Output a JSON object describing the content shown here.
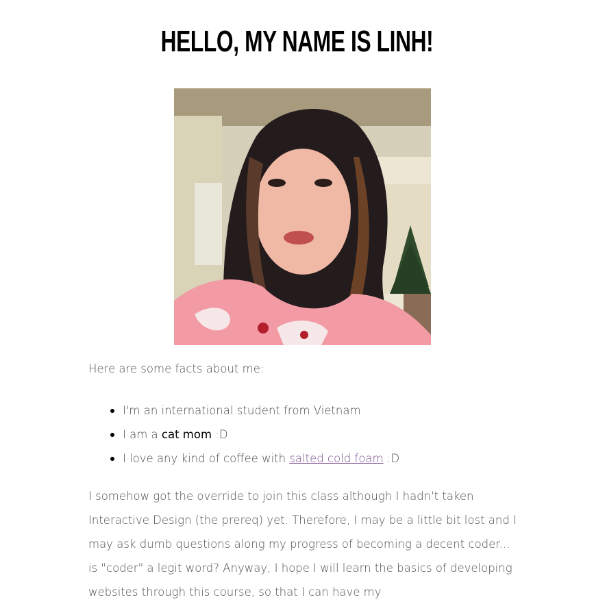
{
  "header": {
    "title": "Hello, my name is Linh!"
  },
  "photo": {
    "alt": "Portrait photo of Linh"
  },
  "intro": {
    "text": "Here are some facts about me:"
  },
  "facts": {
    "item1": {
      "text": "I'm an international student from Vietnam"
    },
    "item2": {
      "prefix": "I am a ",
      "strong": "cat mom",
      "suffix": " :D"
    },
    "item3": {
      "prefix": "I love any kind of coffee with ",
      "link": "salted cold foam",
      "suffix": " :D"
    }
  },
  "paragraph": {
    "text": "I somehow got the override to join this class although I hadn't taken Interactive Design (the prereq) yet. Therefore, I may be a little bit lost and I may ask dumb questions along my progress of becoming a decent coder... is \"coder\" a legit word? Anyway, I hope I will learn the basics of developing websites through this course, so that I can have my"
  },
  "colors": {
    "link": "#7a4f8f",
    "text": "#4d4d4d",
    "title": "#000000"
  }
}
